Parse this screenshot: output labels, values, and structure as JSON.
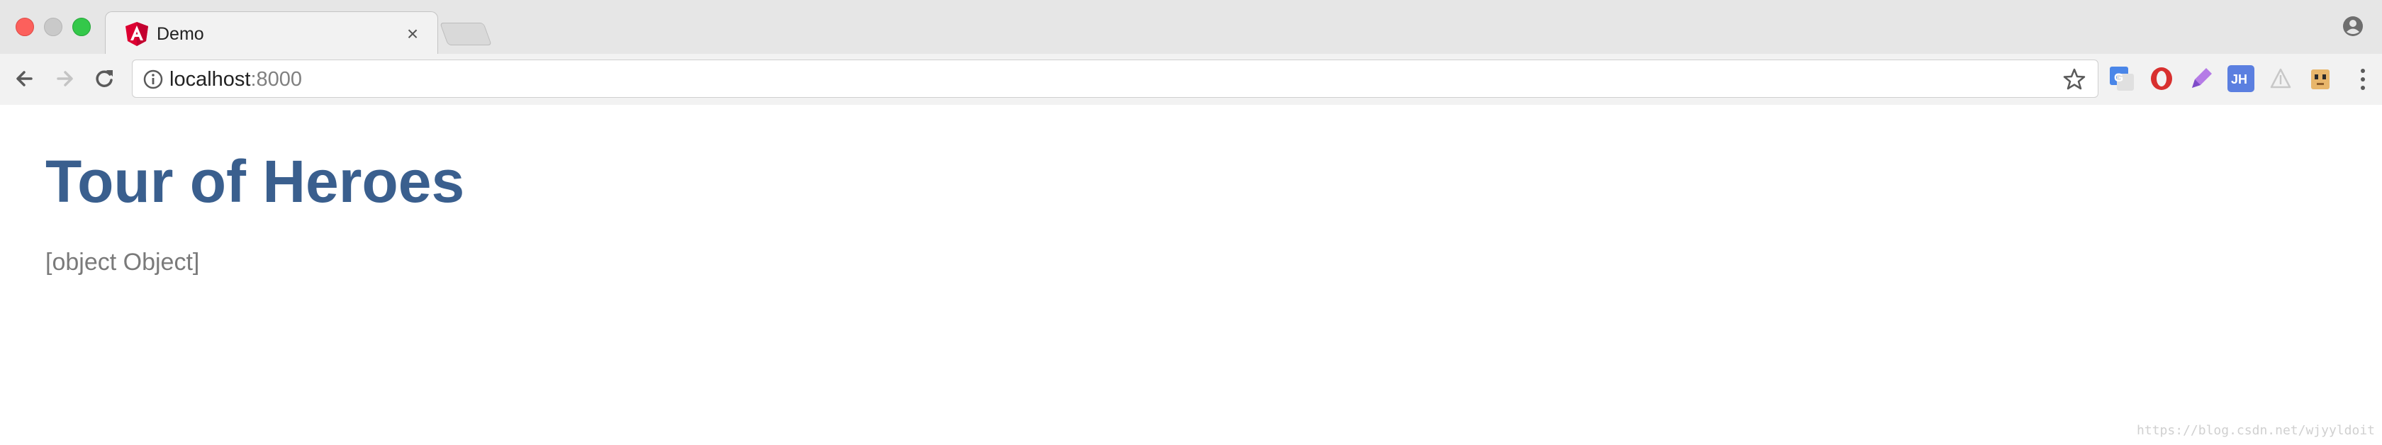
{
  "browser": {
    "tab": {
      "title": "Demo",
      "favicon": "angular-icon",
      "close_glyph": "×"
    },
    "address": {
      "host": "localhost",
      "port": ":8000"
    },
    "extensions": [
      "google-translate-icon",
      "opera-icon",
      "pen-icon",
      "jh-icon",
      "triangle-icon",
      "character-icon"
    ],
    "ext_jh_label": "JH"
  },
  "page": {
    "title": "Tour of Heroes",
    "body_text": "[object Object]"
  },
  "watermark": "https://blog.csdn.net/wjyyldoit",
  "colors": {
    "title": "#3a5f8e",
    "body_text": "#7a7a7a",
    "angular_red": "#dd0031"
  }
}
